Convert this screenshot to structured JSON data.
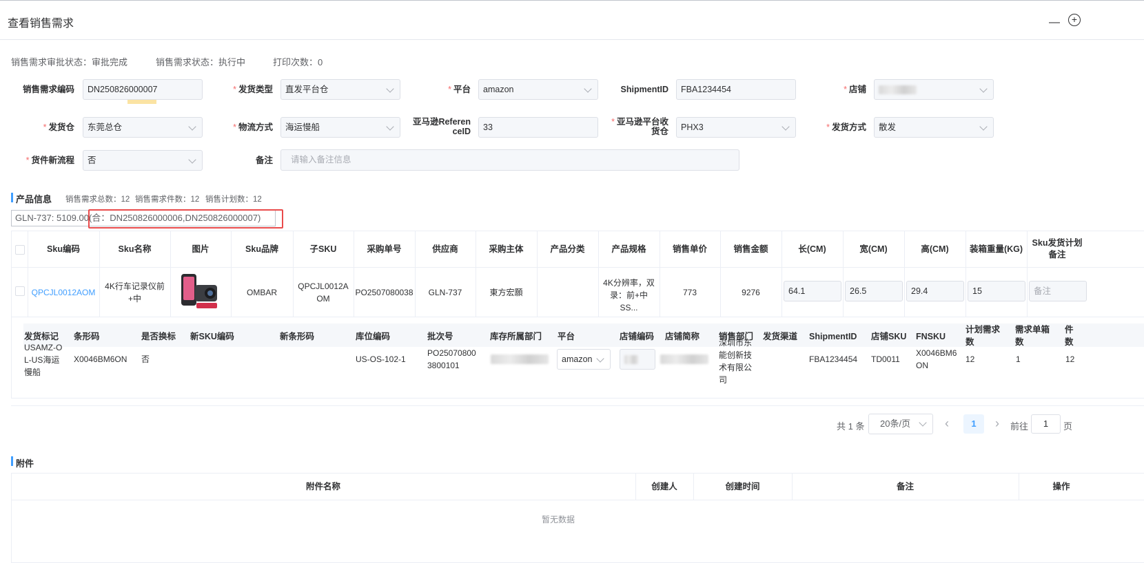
{
  "header": {
    "title": "查看销售需求",
    "minimize": "—",
    "maximize": "+"
  },
  "status": {
    "approval": "销售需求审批状态：审批完成",
    "state": "销售需求状态：执行中",
    "print_count": "打印次数：0"
  },
  "form": {
    "demand_code": {
      "label": "销售需求编码",
      "value": "DN250826000007"
    },
    "ship_type": {
      "label": "发货类型",
      "value": "直发平台仓"
    },
    "platform": {
      "label": "平台",
      "value": "amazon"
    },
    "shipment_id": {
      "label": "ShipmentID",
      "value": "FBA1234454"
    },
    "shop": {
      "label": "店铺",
      "value": ""
    },
    "warehouse": {
      "label": "发货仓",
      "value": "东莞总仓"
    },
    "logistics": {
      "label": "物流方式",
      "value": "海运慢船"
    },
    "amazon_ref_line1": "亚马逊Referen",
    "amazon_ref_line2": "ceID",
    "amazon_ref_value": "33",
    "amazon_wh_line1": "亚马逊平台收",
    "amazon_wh_line2": "货仓",
    "amazon_wh_value": "PHX3",
    "ship_method": {
      "label": "发货方式",
      "value": "散发"
    },
    "new_flow": {
      "label": "货件新流程",
      "value": "否"
    },
    "remark": {
      "label": "备注",
      "placeholder": "请输入备注信息"
    }
  },
  "products": {
    "section_title": "产品信息",
    "total": "销售需求总数：12",
    "pieces": "销售需求件数：12",
    "plan": "销售计划数：12",
    "merge_text": "GLN-737: 5109.00(合：DN250826000006,DN250826000007)",
    "columns": [
      "Sku编码",
      "Sku名称",
      "图片",
      "Sku品牌",
      "子SKU",
      "采购单号",
      "供应商",
      "采购主体",
      "产品分类",
      "产品规格",
      "销售单价",
      "销售金额",
      "长(CM)",
      "宽(CM)",
      "高(CM)",
      "装箱重量(KG)",
      "Sku发货计划备注"
    ],
    "row": {
      "sku_code": "QPCJL0012AOM",
      "sku_name": "4K行车记录仪前+中",
      "brand": "OMBAR",
      "child_sku": "QPCJL0012AOM",
      "po": "PO2507080038",
      "supplier": "GLN-737",
      "purchaser": "東方宏願",
      "category": "",
      "spec": "4K分辨率，双录：前+中 SS...",
      "unit_price": "773",
      "amount": "9276",
      "length": "64.1",
      "width": "26.5",
      "height": "29.4",
      "weight": "15",
      "remark_placeholder": "备注"
    },
    "sub_columns": [
      "发货标记",
      "条形码",
      "是否换标",
      "新SKU编码",
      "新条形码",
      "库位编码",
      "批次号",
      "库存所属部门",
      "平台",
      "店铺编码",
      "店铺简称",
      "销售部门",
      "发货渠道",
      "ShipmentID",
      "店铺SKU",
      "FNSKU",
      "计划需求数",
      "需求单箱数",
      "件数"
    ],
    "sub_row": {
      "mark": "USAMZ-OL-US海运慢船",
      "barcode": "X0046BM6ON",
      "relabel": "否",
      "new_sku": "",
      "new_barcode": "",
      "location": "US-OS-102-1",
      "batch": "PO250708003800101",
      "platform": "amazon",
      "dept": "深圳市东能创新技术有限公司",
      "channel": "",
      "shipment_id": "FBA1234454",
      "shop_sku": "TD0011",
      "fnsku": "X0046BM6ON",
      "plan_qty": "12",
      "box_qty": "1",
      "pieces": "12"
    }
  },
  "pager": {
    "total": "共 1 条",
    "size": "20条/页",
    "current": "1",
    "goto_label": "前往",
    "goto_value": "1",
    "page_suffix": "页",
    "prev": "‹",
    "next": "›"
  },
  "attachments": {
    "section_title": "附件",
    "columns": [
      "附件名称",
      "创建人",
      "创建时间",
      "备注",
      "操作"
    ],
    "empty": "暂无数据"
  },
  "colors": {
    "accent": "#409eff",
    "required": "#f56c6c",
    "highlight_box": "#e94b4b"
  }
}
